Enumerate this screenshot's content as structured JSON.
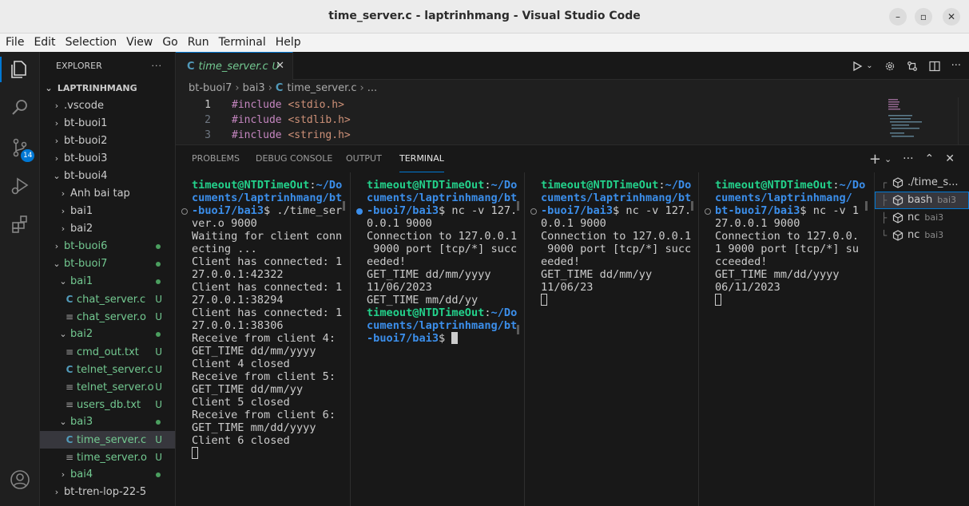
{
  "window": {
    "title": "time_server.c - laptrinhmang - Visual Studio Code",
    "minimize": "–",
    "maximize": "▫",
    "close": "✕"
  },
  "menu": [
    "File",
    "Edit",
    "Selection",
    "View",
    "Go",
    "Run",
    "Terminal",
    "Help"
  ],
  "activity": {
    "source_control_badge": "14"
  },
  "explorer": {
    "header": "EXPLORER",
    "more": "···",
    "root": "LAPTRINHMANG",
    "items": [
      {
        "label": ".vscode",
        "type": "folder",
        "expanded": false,
        "depth": 1
      },
      {
        "label": "bt-buoi1",
        "type": "folder",
        "expanded": false,
        "depth": 1
      },
      {
        "label": "bt-buoi2",
        "type": "folder",
        "expanded": false,
        "depth": 1
      },
      {
        "label": "bt-buoi3",
        "type": "folder",
        "expanded": false,
        "depth": 1
      },
      {
        "label": "bt-buoi4",
        "type": "folder",
        "expanded": true,
        "depth": 1
      },
      {
        "label": "Anh bai tap",
        "type": "folder",
        "expanded": false,
        "depth": 2
      },
      {
        "label": "bai1",
        "type": "folder",
        "expanded": false,
        "depth": 2
      },
      {
        "label": "bai2",
        "type": "folder",
        "expanded": false,
        "depth": 2
      },
      {
        "label": "bt-buoi6",
        "type": "folder",
        "expanded": false,
        "depth": 1,
        "dot": true
      },
      {
        "label": "bt-buoi7",
        "type": "folder",
        "expanded": true,
        "depth": 1,
        "dot": true
      },
      {
        "label": "bai1",
        "type": "folder",
        "expanded": true,
        "depth": 2,
        "dot": true
      },
      {
        "label": "chat_server.c",
        "type": "c",
        "depth": 3,
        "status": "U"
      },
      {
        "label": "chat_server.o",
        "type": "txt",
        "depth": 3,
        "status": "U"
      },
      {
        "label": "bai2",
        "type": "folder",
        "expanded": true,
        "depth": 2,
        "dot": true
      },
      {
        "label": "cmd_out.txt",
        "type": "txt",
        "depth": 3,
        "status": "U"
      },
      {
        "label": "telnet_server.c",
        "type": "c",
        "depth": 3,
        "status": "U"
      },
      {
        "label": "telnet_server.o",
        "type": "txt",
        "depth": 3,
        "status": "U"
      },
      {
        "label": "users_db.txt",
        "type": "txt",
        "depth": 3,
        "status": "U"
      },
      {
        "label": "bai3",
        "type": "folder",
        "expanded": true,
        "depth": 2,
        "dot": true
      },
      {
        "label": "time_server.c",
        "type": "c",
        "depth": 3,
        "status": "U",
        "selected": true
      },
      {
        "label": "time_server.o",
        "type": "txt",
        "depth": 3,
        "status": "U"
      },
      {
        "label": "bai4",
        "type": "folder",
        "expanded": false,
        "depth": 2,
        "dot": true
      },
      {
        "label": "bt-tren-lop-22-5",
        "type": "folder",
        "expanded": false,
        "depth": 1
      }
    ]
  },
  "editor": {
    "tab": {
      "icon": "C",
      "label": "time_server.c",
      "status": "U",
      "close": "✕"
    },
    "breadcrumb": [
      "bt-buoi7",
      "bai3",
      "time_server.c",
      "..."
    ],
    "lines": [
      {
        "n": "1",
        "kw": "#include",
        "arg": "<stdio.h>"
      },
      {
        "n": "2",
        "kw": "#include",
        "arg": "<stdlib.h>"
      },
      {
        "n": "3",
        "kw": "#include",
        "arg": "<string.h>"
      }
    ]
  },
  "panel": {
    "tabs": [
      "PROBLEMS",
      "DEBUG CONSOLE",
      "OUTPUT",
      "TERMINAL"
    ],
    "active_tab": "TERMINAL",
    "tools": [
      "+",
      "⌄",
      "···",
      "⌃",
      "✕"
    ]
  },
  "terminals": [
    {
      "lines": [
        [
          {
            "t": "timeout@NTDTimeOut",
            "c": "p-user"
          },
          {
            "t": ":",
            "c": ""
          },
          {
            "t": "~/Do",
            "c": "p-path"
          }
        ],
        [
          {
            "t": "cuments/laptrinhmang/bt",
            "c": "p-path"
          }
        ],
        [
          {
            "t": "-buoi7/bai3",
            "c": "p-path"
          },
          {
            "t": "$ ./time_ser",
            "c": ""
          }
        ],
        [
          {
            "t": "ver.o 9000",
            "c": ""
          }
        ],
        [
          {
            "t": "Waiting for client conn",
            "c": ""
          }
        ],
        [
          {
            "t": "ecting ...",
            "c": ""
          }
        ],
        [
          {
            "t": "Client has connected: 1",
            "c": ""
          }
        ],
        [
          {
            "t": "27.0.0.1:42322",
            "c": ""
          }
        ],
        [
          {
            "t": "Client has connected: 1",
            "c": ""
          }
        ],
        [
          {
            "t": "27.0.0.1:38294",
            "c": ""
          }
        ],
        [
          {
            "t": "Client has connected: 1",
            "c": ""
          }
        ],
        [
          {
            "t": "27.0.0.1:38306",
            "c": ""
          }
        ],
        [
          {
            "t": "Receive from client 4:",
            "c": ""
          }
        ],
        [
          {
            "t": "GET_TIME dd/mm/yyyy",
            "c": ""
          }
        ],
        [
          {
            "t": "Client 4 closed",
            "c": ""
          }
        ],
        [
          {
            "t": "Receive from client 5:",
            "c": ""
          }
        ],
        [
          {
            "t": "GET_TIME dd/mm/yy",
            "c": ""
          }
        ],
        [
          {
            "t": "Client 5 closed",
            "c": ""
          }
        ],
        [
          {
            "t": "Receive from client 6:",
            "c": ""
          }
        ],
        [
          {
            "t": "GET_TIME mm/dd/yyyy",
            "c": ""
          }
        ],
        [
          {
            "t": "Client 6 closed",
            "c": ""
          }
        ]
      ]
    },
    {
      "lines": [
        [
          {
            "t": "timeout@NTDTimeOut",
            "c": "p-user"
          },
          {
            "t": ":",
            "c": ""
          },
          {
            "t": "~/Do",
            "c": "p-path"
          }
        ],
        [
          {
            "t": "cuments/laptrinhmang/bt",
            "c": "p-path"
          }
        ],
        [
          {
            "t": "-buoi7/bai3",
            "c": "p-path"
          },
          {
            "t": "$ nc -v 127.",
            "c": ""
          }
        ],
        [
          {
            "t": "0.0.1 9000",
            "c": ""
          }
        ],
        [
          {
            "t": "Connection to 127.0.0.1",
            "c": ""
          }
        ],
        [
          {
            "t": " 9000 port [tcp/*] succ",
            "c": ""
          }
        ],
        [
          {
            "t": "eeded!",
            "c": ""
          }
        ],
        [
          {
            "t": "GET_TIME dd/mm/yyyy",
            "c": ""
          }
        ],
        [
          {
            "t": "11/06/2023",
            "c": ""
          }
        ],
        [
          {
            "t": "GET_TIME mm/dd/yy",
            "c": ""
          }
        ],
        [
          {
            "t": "timeout@NTDTimeOut",
            "c": "p-user"
          },
          {
            "t": ":",
            "c": ""
          },
          {
            "t": "~/Do",
            "c": "p-path"
          }
        ],
        [
          {
            "t": "cuments/laptrinhmang/bt",
            "c": "p-path"
          }
        ],
        [
          {
            "t": "-buoi7/bai3",
            "c": "p-path"
          },
          {
            "t": "$ ",
            "c": ""
          }
        ]
      ]
    },
    {
      "lines": [
        [
          {
            "t": "timeout@NTDTimeOut",
            "c": "p-user"
          },
          {
            "t": ":",
            "c": ""
          },
          {
            "t": "~/Do",
            "c": "p-path"
          }
        ],
        [
          {
            "t": "cuments/laptrinhmang/bt",
            "c": "p-path"
          }
        ],
        [
          {
            "t": "-buoi7/bai3",
            "c": "p-path"
          },
          {
            "t": "$ nc -v 127.",
            "c": ""
          }
        ],
        [
          {
            "t": "0.0.1 9000",
            "c": ""
          }
        ],
        [
          {
            "t": "Connection to 127.0.0.1",
            "c": ""
          }
        ],
        [
          {
            "t": " 9000 port [tcp/*] succ",
            "c": ""
          }
        ],
        [
          {
            "t": "eeded!",
            "c": ""
          }
        ],
        [
          {
            "t": "GET_TIME dd/mm/yy",
            "c": ""
          }
        ],
        [
          {
            "t": "11/06/23",
            "c": ""
          }
        ]
      ]
    },
    {
      "lines": [
        [
          {
            "t": "timeout@NTDTimeOut",
            "c": "p-user"
          },
          {
            "t": ":",
            "c": ""
          },
          {
            "t": "~/Do",
            "c": "p-path"
          }
        ],
        [
          {
            "t": "cuments/laptrinhmang/",
            "c": "p-path"
          }
        ],
        [
          {
            "t": "bt-buoi7/bai3",
            "c": "p-path"
          },
          {
            "t": "$ nc -v 1",
            "c": ""
          }
        ],
        [
          {
            "t": "27.0.0.1 9000",
            "c": ""
          }
        ],
        [
          {
            "t": "Connection to 127.0.0.",
            "c": ""
          }
        ],
        [
          {
            "t": "1 9000 port [tcp/*] su",
            "c": ""
          }
        ],
        [
          {
            "t": "cceeded!",
            "c": ""
          }
        ],
        [
          {
            "t": "GET_TIME mm/dd/yyyy",
            "c": ""
          }
        ],
        [
          {
            "t": "06/11/2023",
            "c": ""
          }
        ]
      ]
    }
  ],
  "terminal_list": [
    {
      "name": "./time_s...",
      "sub": ""
    },
    {
      "name": "bash",
      "sub": "bai3",
      "selected": true
    },
    {
      "name": "nc",
      "sub": "bai3"
    },
    {
      "name": "nc",
      "sub": "bai3"
    }
  ],
  "colors": {
    "accent": "#0078d4",
    "prompt_user": "#23d18b",
    "prompt_path": "#3b8eea",
    "untracked": "#73c991"
  }
}
